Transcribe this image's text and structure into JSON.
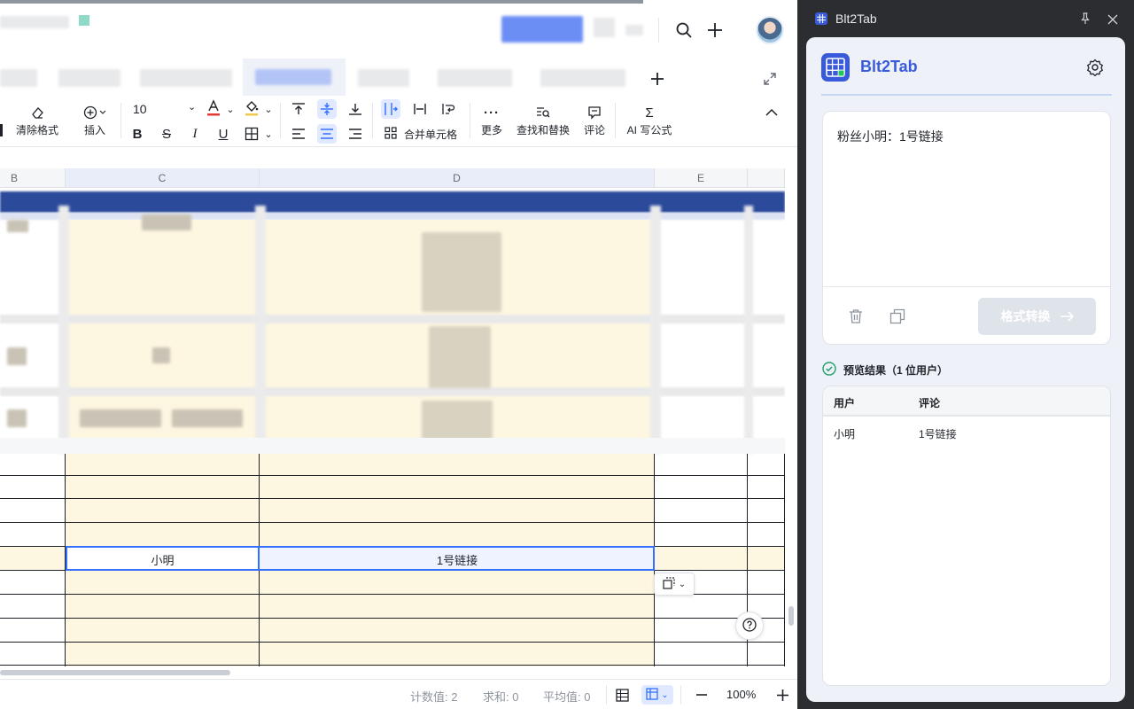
{
  "toolbar": {
    "clear_format": "清除格式",
    "insert": "插入",
    "font_size": "10",
    "merge_cells": "合并单元格",
    "more": "更多",
    "find_replace": "查找和替换",
    "comment": "评论",
    "ai_formula": "AI 写公式"
  },
  "columns": [
    "B",
    "C",
    "D",
    "E"
  ],
  "selected_row": {
    "user": "小明",
    "comment": "1号链接"
  },
  "status": {
    "count": "计数值: 2",
    "sum": "求和: 0",
    "average": "平均值: 0",
    "zoom": "100%"
  },
  "extension": {
    "window_title": "Blt2Tab",
    "app_name": "Blt2Tab",
    "input_text": "粉丝小明：1号链接",
    "convert_button": "格式转换",
    "preview_label": "预览结果（1 位用户）",
    "table_headers": [
      "用户",
      "评论"
    ],
    "table_rows": [
      [
        "小明",
        "1号链接"
      ]
    ]
  },
  "colors": {
    "accent": "#3370ff",
    "brand_blue": "#3a5bd9",
    "header_band": "#2b4a9a",
    "row_fill": "#fdf6e0",
    "success": "#22a06b"
  }
}
